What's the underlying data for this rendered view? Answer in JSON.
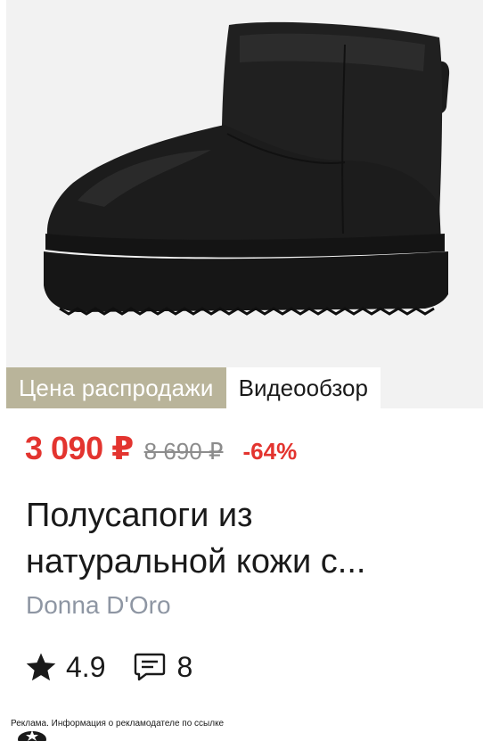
{
  "product": {
    "badges": {
      "sale": "Цена распродажи",
      "video": "Видеообзор"
    },
    "price": {
      "current": "3 090 ₽",
      "old": "8 690 ₽",
      "discount": "-64%"
    },
    "title": "Полусапоги из натуральной кожи с...",
    "brand": "Donna D'Oro",
    "rating": "4.9",
    "reviews": "8"
  },
  "ad": {
    "text": "Реклама. Информация о рекламодателе по ссылке"
  },
  "colors": {
    "price_red": "#e3342f",
    "sale_badge": "#b9b49a",
    "brand_gray": "#8e96a3"
  },
  "icons": [
    "star-icon",
    "comment-icon"
  ]
}
